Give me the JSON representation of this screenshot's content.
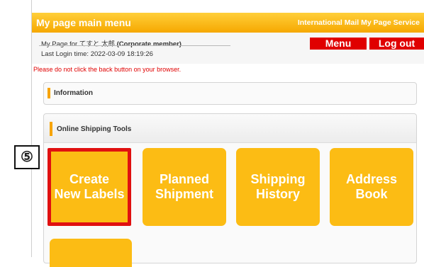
{
  "header": {
    "title": "My page main menu",
    "service": "International Mail My Page Service"
  },
  "user": {
    "prefix": "My Page for ",
    "name": "てすと 太郎",
    "member_type": "(Corporate member)",
    "last_login": "Last Login time: 2022-03-09 18:19:26"
  },
  "buttons": {
    "menu": "Menu",
    "logout": "Log out"
  },
  "warning": "Please do not click the back button on your browser.",
  "information": {
    "label": "Information"
  },
  "tools": {
    "label": "Online Shipping Tools",
    "tiles": [
      {
        "label": "Create\nNew Labels"
      },
      {
        "label": "Planned\nShipment"
      },
      {
        "label": "Shipping\nHistory"
      },
      {
        "label": "Address\nBook"
      }
    ]
  },
  "annotation": {
    "step": "⑤"
  },
  "colors": {
    "header_orange": "#f6a800",
    "tile_yellow": "#fcbc14",
    "alert_red": "#e00000"
  }
}
